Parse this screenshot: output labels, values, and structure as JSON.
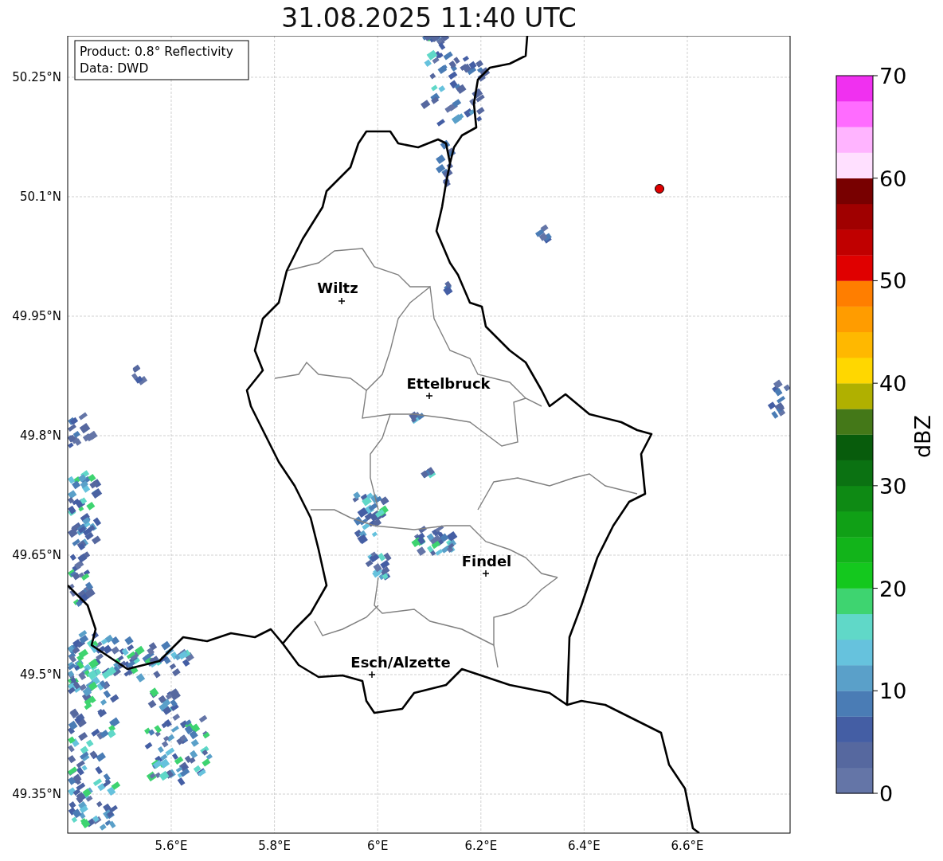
{
  "title": "31.08.2025 11:40 UTC",
  "info_box": [
    "Product: 0.8° Reflectivity",
    "Data: DWD"
  ],
  "lat_ticks": [
    "50.25°N",
    "50.1°N",
    "49.95°N",
    "49.8°N",
    "49.65°N",
    "49.5°N",
    "49.35°N"
  ],
  "lon_ticks": [
    "5.6°E",
    "5.8°E",
    "6°E",
    "6.2°E",
    "6.4°E",
    "6.6°E"
  ],
  "cities": [
    {
      "name": "Wiltz"
    },
    {
      "name": "Ettelbruck"
    },
    {
      "name": "Findel"
    },
    {
      "name": "Esch/Alzette"
    }
  ],
  "colorbar": {
    "label": "dBZ",
    "ticks": [
      "70",
      "60",
      "50",
      "40",
      "30",
      "20",
      "10",
      "0"
    ],
    "bins": [
      {
        "color": "#6475a7"
      },
      {
        "color": "#56689f"
      },
      {
        "color": "#445ea4"
      },
      {
        "color": "#4a7cb5"
      },
      {
        "color": "#5aa0c9"
      },
      {
        "color": "#66c2dd"
      },
      {
        "color": "#60d8c8"
      },
      {
        "color": "#3ed470"
      },
      {
        "color": "#14c81e"
      },
      {
        "color": "#12b41a"
      },
      {
        "color": "#10a016"
      },
      {
        "color": "#0e8a14"
      },
      {
        "color": "#0b7212"
      },
      {
        "color": "#085c0c"
      },
      {
        "color": "#447818"
      },
      {
        "color": "#b0b000"
      },
      {
        "color": "#ffd700"
      },
      {
        "color": "#ffb800"
      },
      {
        "color": "#ff9c00"
      },
      {
        "color": "#ff7e00"
      },
      {
        "color": "#e00000"
      },
      {
        "color": "#c00000"
      },
      {
        "color": "#a00000"
      },
      {
        "color": "#780000"
      },
      {
        "color": "#ffe0ff"
      },
      {
        "color": "#ffb4ff"
      },
      {
        "color": "#ff6cff"
      },
      {
        "color": "#f030f0"
      }
    ]
  }
}
